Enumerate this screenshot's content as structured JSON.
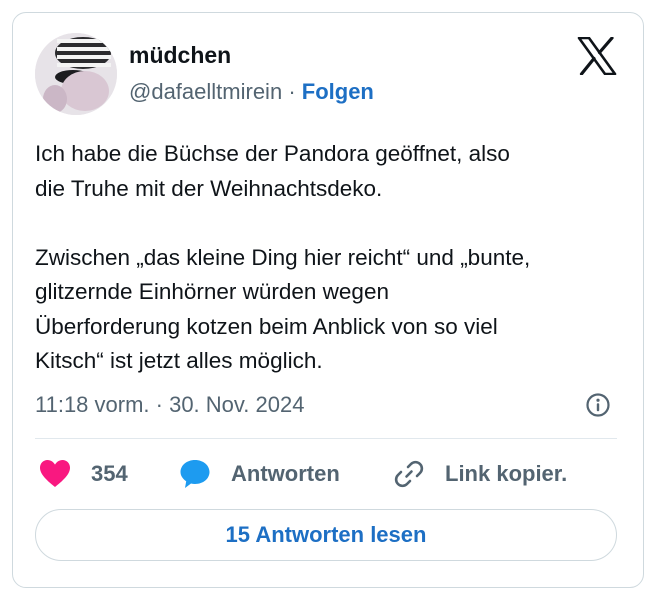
{
  "author": {
    "display_name": "müdchen",
    "handle": "@dafaelltmirein",
    "separator": "·",
    "follow_label": "Folgen"
  },
  "tweet": {
    "text": "Ich habe die Büchse der Pandora geöffnet, also\ndie Truhe mit der Weihnachtsdeko.\n\nZwischen „das kleine Ding hier reicht“ und „bunte,\nglitzernde Einhörner würden wegen\nÜberforderung kotzen beim Anblick von so viel\nKitsch“ ist jetzt alles möglich.",
    "timestamp": "11:18 vorm. · 30. Nov. 2024"
  },
  "actions": {
    "like_count": "354",
    "reply_label": "Antworten",
    "copy_link_label": "Link kopier.",
    "read_replies_label": "15 Antworten lesen"
  },
  "icons": {
    "brand": "x-logo",
    "info": "info-icon",
    "like": "heart-icon",
    "reply": "speech-bubble-icon",
    "link": "link-icon"
  },
  "colors": {
    "text": "#0f1419",
    "secondary": "#536471",
    "link": "#1d6fc4",
    "heart": "#f91880",
    "reply_bubble": "#1d9bf0",
    "border": "#cfd9de"
  }
}
